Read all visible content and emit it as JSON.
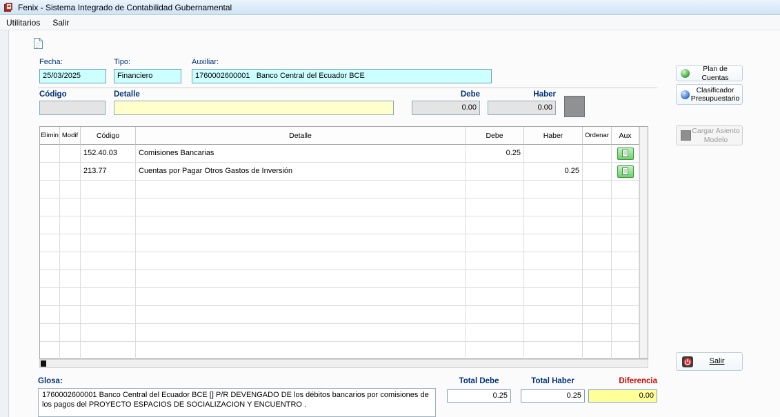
{
  "window": {
    "title": "Fenix - Sistema Integrado de Contabilidad Gubernamental"
  },
  "menu": {
    "items": [
      "Utilitarios",
      "Salir"
    ]
  },
  "form": {
    "fecha": {
      "label": "Fecha:",
      "value": "25/03/2025"
    },
    "tipo": {
      "label": "Tipo:",
      "value": "Financiero"
    },
    "auxiliar": {
      "label": "Auxiliar:",
      "value": "1760002600001   Banco Central del Ecuador BCE"
    }
  },
  "entry": {
    "codigo_label": "Código",
    "detalle_label": "Detalle",
    "debe_label": "Debe",
    "haber_label": "Haber",
    "codigo_value": "",
    "detalle_value": "",
    "debe_value": "0.00",
    "haber_value": "0.00"
  },
  "table": {
    "headers": [
      "Elimin",
      "Modif",
      "Código",
      "Detalle",
      "Debe",
      "Haber",
      "Ordenar",
      "Aux"
    ],
    "rows": [
      {
        "elimin": "",
        "modif": "",
        "codigo": "152.40.03",
        "detalle": "Comisiones Bancarias",
        "debe": "0.25",
        "haber": "",
        "ordenar": ""
      },
      {
        "elimin": "",
        "modif": "",
        "codigo": "213.77",
        "detalle": "Cuentas por Pagar Otros Gastos de Inversión",
        "debe": "",
        "haber": "0.25",
        "ordenar": ""
      }
    ]
  },
  "side_panel": {
    "plan_de_cuentas": "Plan de Cuentas",
    "clasificador": "Clasificador Presupuestario",
    "cargar_asiento": "Cargar Asiento Modelo",
    "salir": "Salir"
  },
  "footer": {
    "glosa": {
      "label": "Glosa:",
      "value": "1760002600001 Banco Central del Ecuador BCE  [] P/R DEVENGADO DE los débitos bancarios por comisiones de los pagos del PROYECTO ESPACIOS DE SOCIALIZACION Y ENCUENTRO ."
    },
    "totals": {
      "debe_label": "Total Debe",
      "debe_value": "0.25",
      "haber_label": "Total Haber",
      "haber_value": "0.25",
      "diferencia_label": "Diferencia",
      "diferencia_value": "0.00"
    }
  },
  "colors": {
    "field_cyan": "#ccffff",
    "field_yellow": "#ffffcc",
    "diferencia_bg": "#ffff99",
    "label_navy": "#003078",
    "diferencia_red": "#d40000",
    "aux_green": "#6fd06f"
  }
}
